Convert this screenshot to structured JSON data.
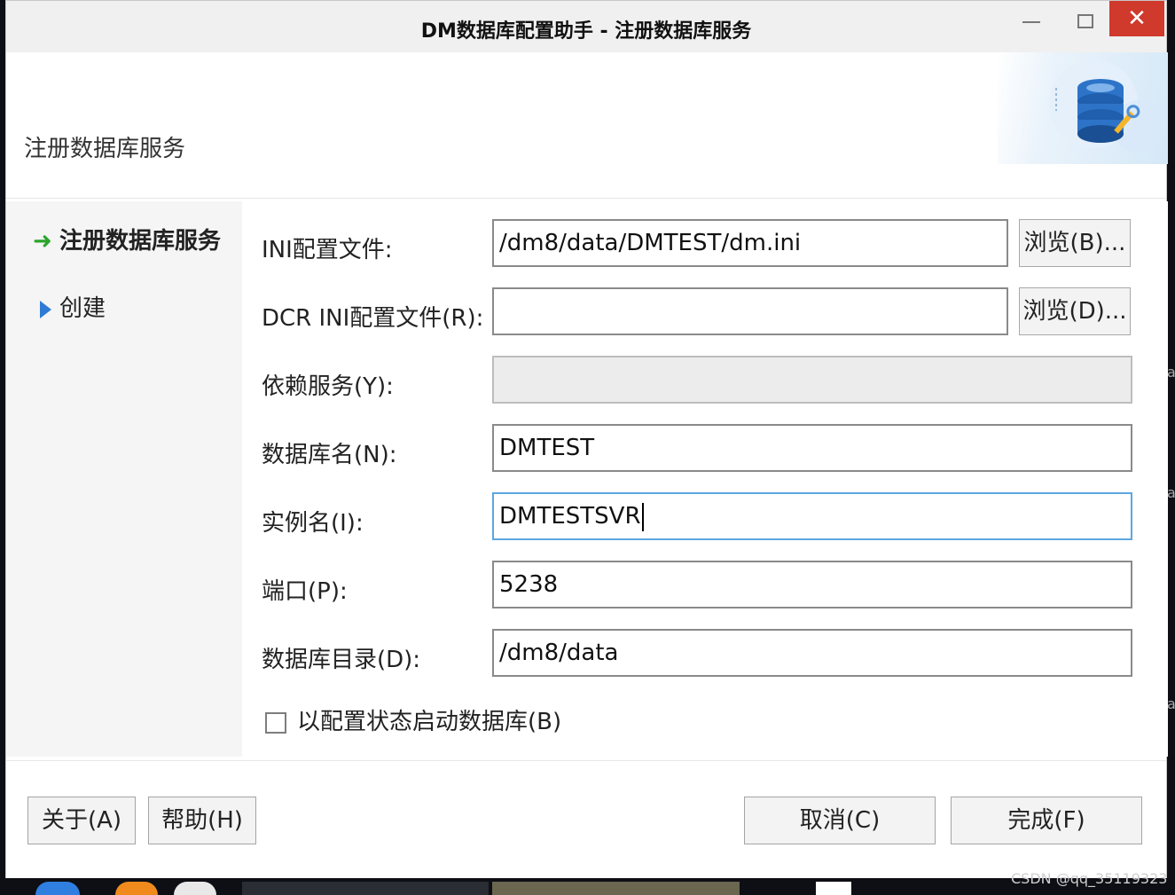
{
  "window": {
    "title": "DM数据库配置助手 - 注册数据库服务",
    "close_glyph": "✕"
  },
  "header": {
    "title": "注册数据库服务"
  },
  "sidebar": {
    "items": [
      {
        "label": "注册数据库服务",
        "active": true
      },
      {
        "label": "创建",
        "active": false
      }
    ]
  },
  "form": {
    "ini_file": {
      "label": "INI配置文件:",
      "value": "/dm8/data/DMTEST/dm.ini",
      "browse_label": "浏览(B)..."
    },
    "dcr_ini_file": {
      "label": "DCR INI配置文件(R):",
      "value": "",
      "browse_label": "浏览(D)..."
    },
    "dependency": {
      "label": "依赖服务(Y):",
      "value": ""
    },
    "db_name": {
      "label": "数据库名(N):",
      "value": "DMTEST"
    },
    "instance_name": {
      "label": "实例名(I):",
      "value": "DMTESTSVR"
    },
    "port": {
      "label": "端口(P):",
      "value": "5238"
    },
    "db_dir": {
      "label": "数据库目录(D):",
      "value": "/dm8/data"
    },
    "start_config_checkbox": {
      "label": "以配置状态启动数据库(B)",
      "checked": false
    }
  },
  "footer": {
    "about_label": "关于(A)",
    "help_label": "帮助(H)",
    "cancel_label": "取消(C)",
    "finish_label": "完成(F)"
  },
  "watermark": "CSDN @qq_35119323",
  "colors": {
    "close_button": "#d03a2c",
    "active_arrow": "#2aa52a",
    "step_triangle": "#2e7bd6",
    "focus_border": "#5da7e0"
  },
  "icons": {
    "active_step": "arrow-right-icon",
    "inactive_step": "triangle-right-icon",
    "header_art": "database-tools-icon"
  }
}
